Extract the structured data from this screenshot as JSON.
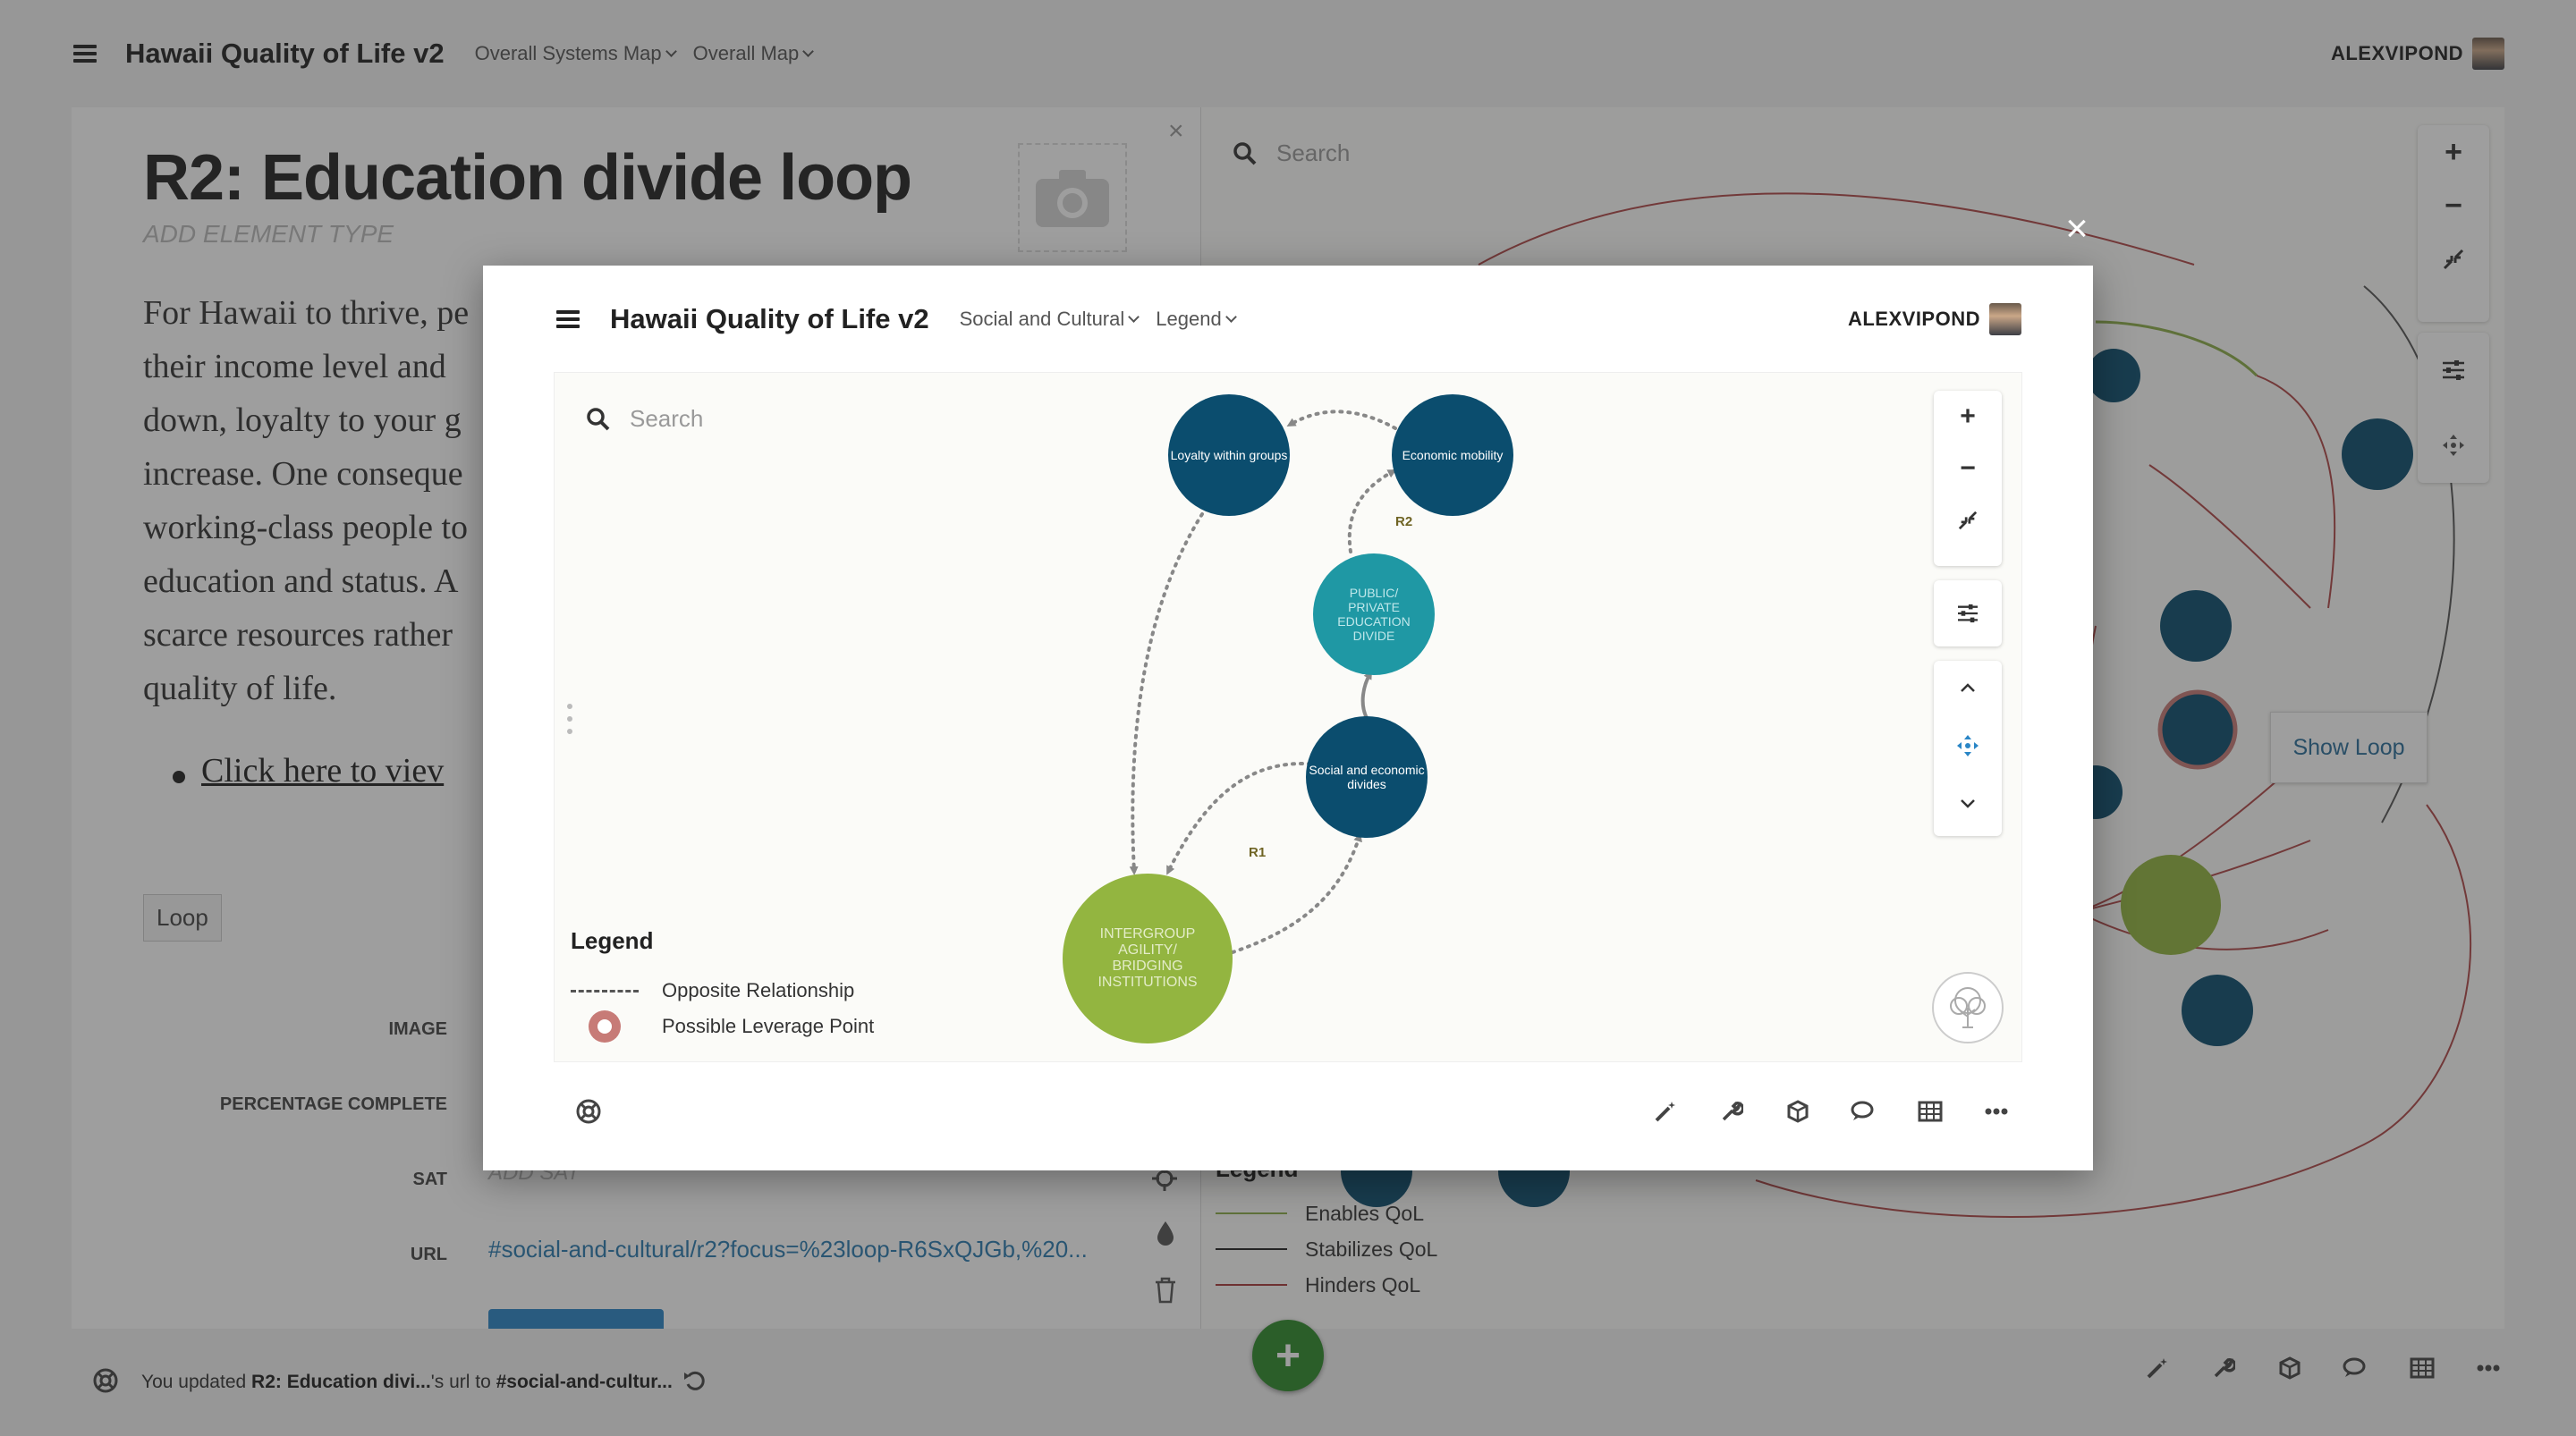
{
  "app": {
    "title": "Hawaii Quality of Life v2",
    "map_dropdown": "Overall Systems Map",
    "view_dropdown": "Overall Map",
    "username": "ALEXVIPOND"
  },
  "element": {
    "title": "R2: Education divide loop",
    "type_placeholder": "ADD ELEMENT TYPE",
    "description": "For Hawaii to thrive, pe\ntheir income level and\ndown, loyalty to your g\nincrease. One conseque\nworking-class people to\neducation and status. A\nscarce resources rather\nquality of life.",
    "link_text": "Click here to viev",
    "tag": "Loop",
    "fields": {
      "image_label": "IMAGE",
      "percentage_label": "PERCENTAGE COMPLETE",
      "sat_label": "SAT",
      "sat_placeholder": "ADD SAT",
      "url_label": "URL",
      "url_value": "#social-and-cultural/r2?focus=%23loop-R6SxQJGb,%20..."
    }
  },
  "bg_map": {
    "search_placeholder": "Search",
    "show_loop": "Show Loop",
    "legend": {
      "title": "Legend",
      "items": [
        {
          "label": "Enables QoL",
          "color": "#8cae4a"
        },
        {
          "label": "Stabilizes QoL",
          "color": "#222222"
        },
        {
          "label": "Hinders QoL",
          "color": "#a83a3a"
        }
      ]
    }
  },
  "status": {
    "prefix": "You updated ",
    "element": "R2: Education divi...",
    "middle": "'s url to ",
    "target": "#social-and-cultur..."
  },
  "modal": {
    "title": "Hawaii Quality of Life v2",
    "map_dropdown": "Social and Cultural",
    "view_dropdown": "Legend",
    "username": "ALEXVIPOND",
    "search_placeholder": "Search",
    "nodes": {
      "loyalty": "Loyalty within groups",
      "economic": "Economic mobility",
      "education": "PUBLIC/ PRIVATE EDUCATION DIVIDE",
      "social": "Social and economic divides",
      "intergroup": "INTERGROUP AGILITY/ BRIDGING INSTITUTIONS"
    },
    "loops": {
      "r2": "R2",
      "r1": "R1"
    },
    "legend": {
      "title": "Legend",
      "opposite": "Opposite Relationship",
      "leverage": "Possible Leverage Point"
    }
  },
  "colors": {
    "node_dark": "#0b4d6e",
    "node_teal": "#1f98a4",
    "node_green": "#93b540",
    "fab_green": "#2e8a2a",
    "link_blue": "#2a7ab0"
  }
}
